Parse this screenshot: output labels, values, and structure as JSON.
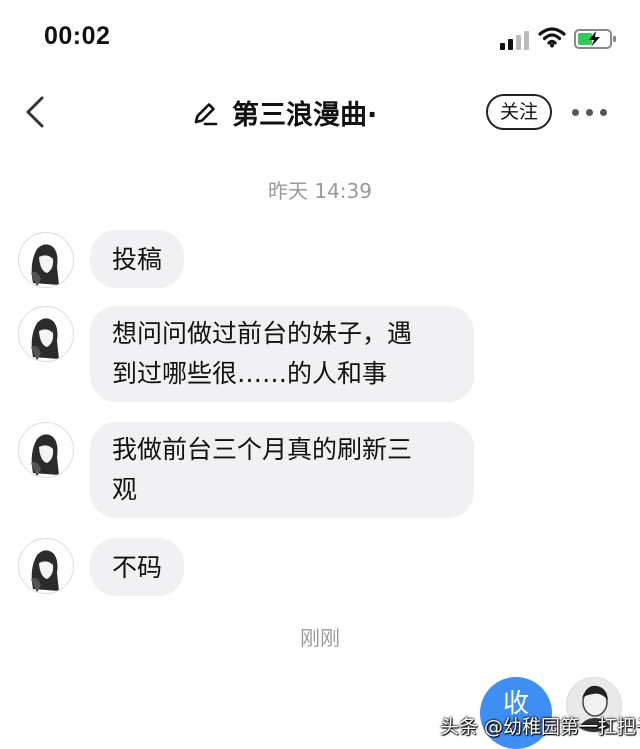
{
  "status_bar": {
    "time": "00:02"
  },
  "header": {
    "title": "第三浪漫曲·",
    "follow_label": "关注"
  },
  "timestamps": {
    "first": "昨天 14:39",
    "second": "刚刚"
  },
  "messages": [
    {
      "text": "投稿"
    },
    {
      "lines": [
        "想问问做过前台的妹子，遇",
        "到过哪些很……的人和事"
      ]
    },
    {
      "lines": [
        "我做前台三个月真的刷新三",
        "观"
      ]
    },
    {
      "text": "不码"
    }
  ],
  "outgoing": {
    "text": "收"
  },
  "watermark": "头条 @幼稚园第一扛把子",
  "colors": {
    "bubble_bg": "#f1f1f4",
    "accent": "#3e8ef4",
    "timestamp": "#9a9a9a"
  }
}
